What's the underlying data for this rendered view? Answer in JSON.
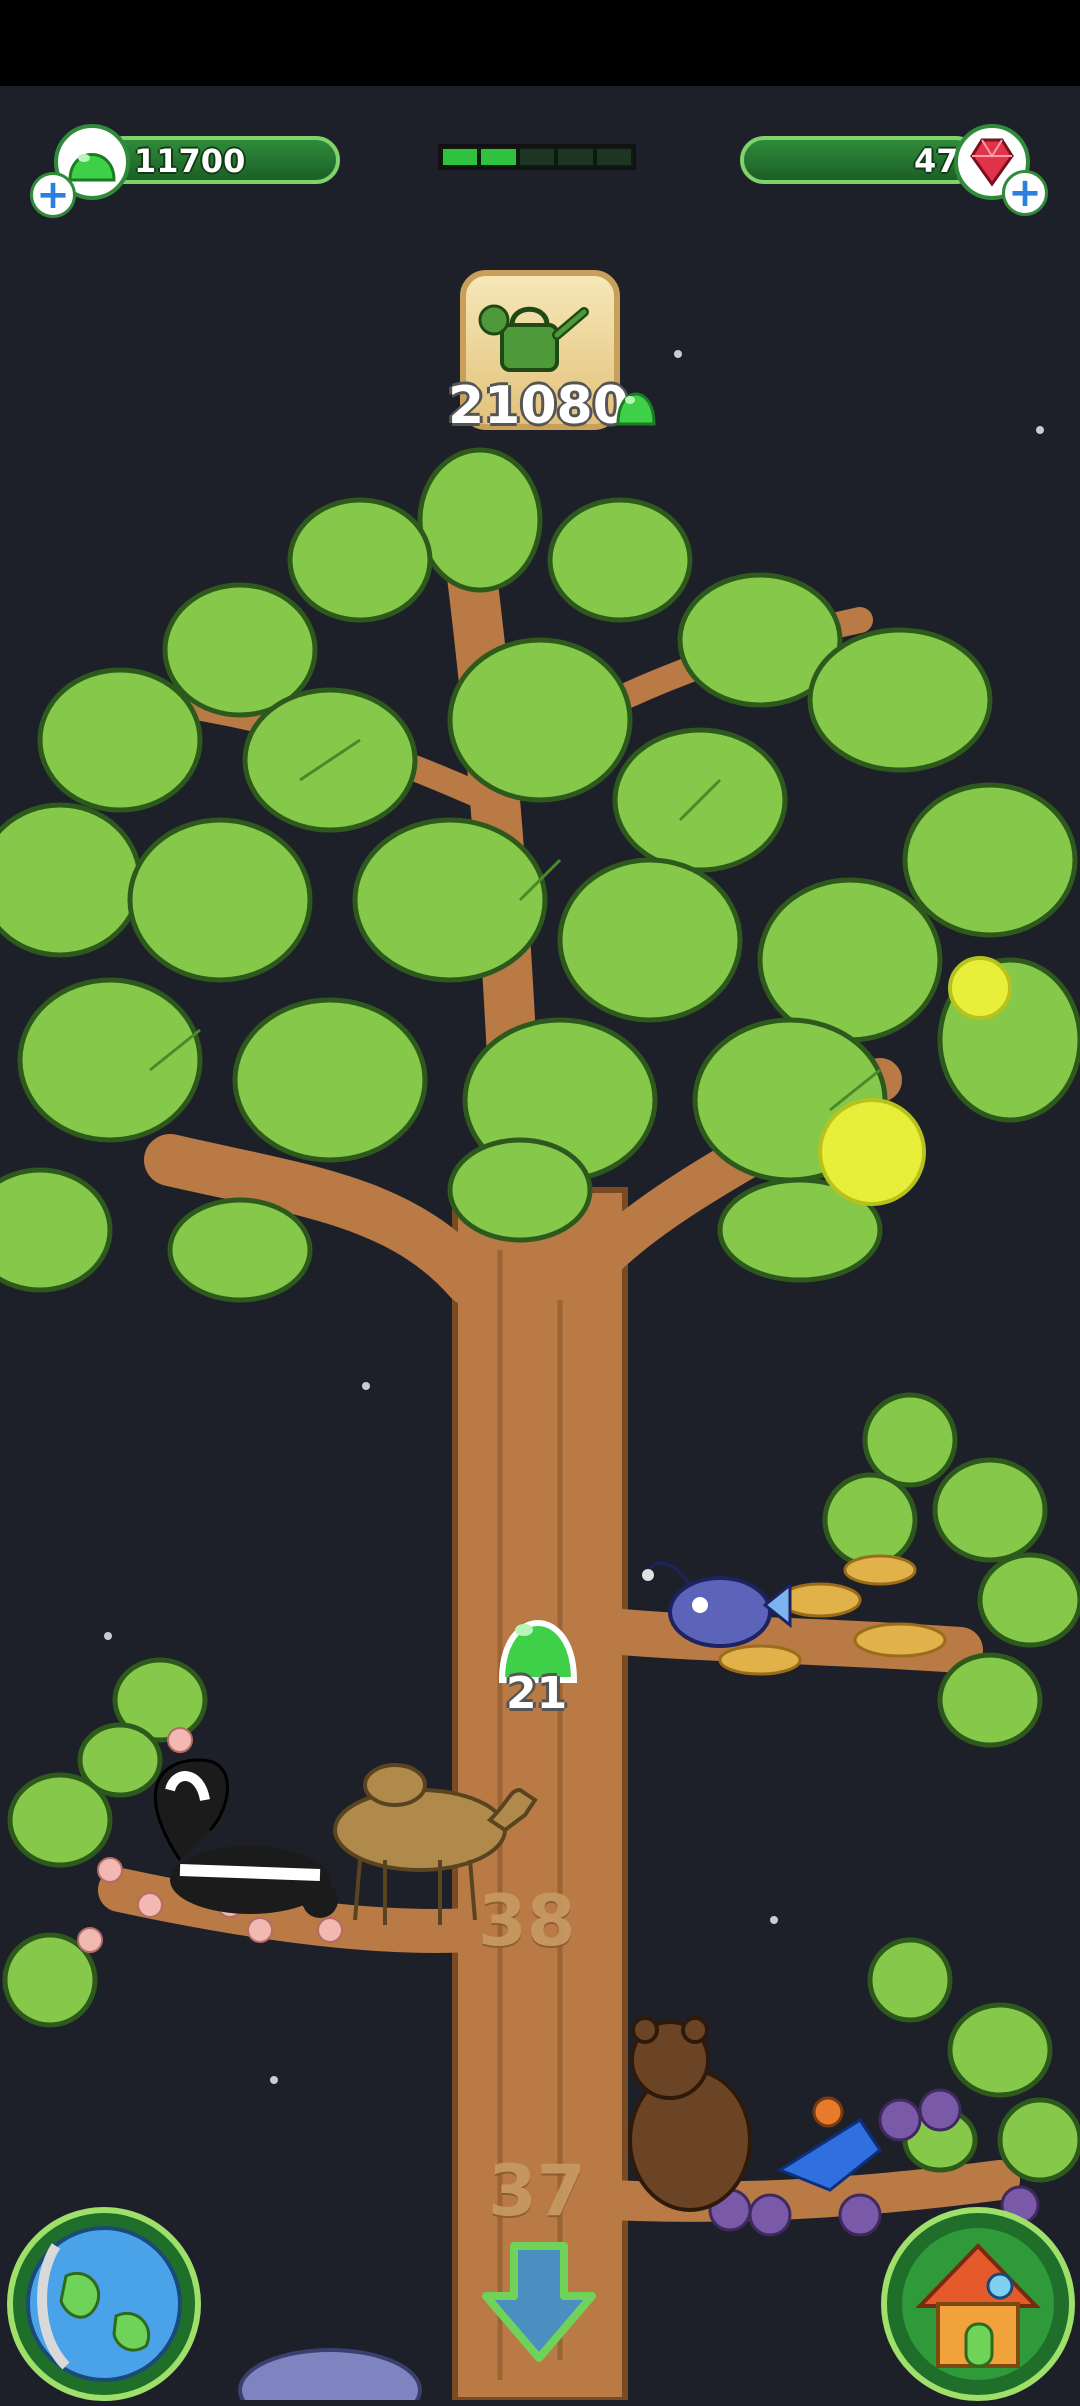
{
  "hud": {
    "jelly_balance": "11700",
    "gem_balance": "47",
    "upgrade_progress": {
      "filled_segments": 2,
      "total_segments": 5
    },
    "watering_cost": "21080"
  },
  "tree": {
    "floating_jelly_value": "21",
    "branch_levels": [
      "38",
      "37"
    ]
  },
  "icons": {
    "jelly": "green-jelly-icon",
    "gem": "red-gem-icon",
    "add": "plus-icon",
    "watering_can": "watering-can-icon",
    "world": "globe-icon",
    "home": "house-icon",
    "scroll_down": "down-arrow-icon"
  },
  "colors": {
    "background": "#1d2029",
    "leaf": "#86c94a",
    "trunk": "#b97a45",
    "jelly_green": "#3fd04a",
    "hud_green": "#2f8b3a"
  }
}
